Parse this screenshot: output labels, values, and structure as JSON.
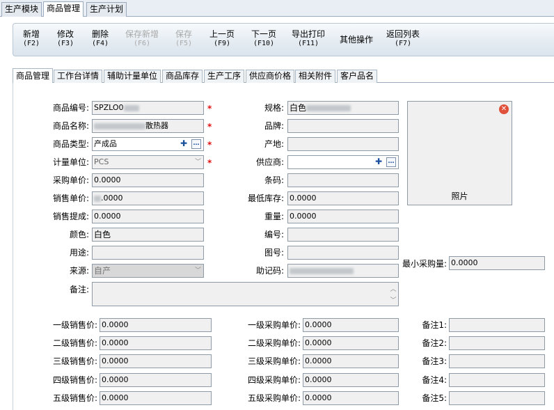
{
  "module_tabs": [
    "生产模块",
    "商品管理",
    "生产计划"
  ],
  "toolbar": {
    "new": {
      "label": "新增",
      "key": "(F2)"
    },
    "edit": {
      "label": "修改",
      "key": "(F3)"
    },
    "delete": {
      "label": "删除",
      "key": "(F4)"
    },
    "save_new": {
      "label": "保存新增",
      "key": "(F6)"
    },
    "save": {
      "label": "保存",
      "key": "(F5)"
    },
    "prev": {
      "label": "上一页",
      "key": "(F9)"
    },
    "next": {
      "label": "下一页",
      "key": "(F10)"
    },
    "export_print": {
      "label": "导出打印",
      "key": "(F11)"
    },
    "other": {
      "label": "其他操作"
    },
    "back": {
      "label": "返回列表",
      "key": "(F7)"
    }
  },
  "sub_tabs": [
    "商品管理",
    "工作台详情",
    "辅助计量单位",
    "商品库存",
    "生产工序",
    "供应商价格",
    "相关附件",
    "客户品名"
  ],
  "form": {
    "code": {
      "label": "商品编号:",
      "value": "SPZLO0"
    },
    "name": {
      "label": "商品名称:",
      "value": "散热器"
    },
    "type": {
      "label": "商品类型:",
      "value": "产成品"
    },
    "unit": {
      "label": "计量单位:",
      "value": "PCS"
    },
    "purchase_price": {
      "label": "采购单价:",
      "value": "0.0000"
    },
    "sale_price": {
      "label": "销售单价:",
      "value": ".0000"
    },
    "commission": {
      "label": "销售提成:",
      "value": "0.0000"
    },
    "color": {
      "label": "颜色:",
      "value": "白色"
    },
    "usage": {
      "label": "用途:",
      "value": ""
    },
    "source": {
      "label": "来源:",
      "value": "自产"
    },
    "remark": {
      "label": "备注:",
      "value": ""
    },
    "spec": {
      "label": "规格:",
      "value": "白色"
    },
    "brand": {
      "label": "品牌:",
      "value": ""
    },
    "origin": {
      "label": "产地:",
      "value": ""
    },
    "supplier": {
      "label": "供应商:",
      "value": ""
    },
    "barcode": {
      "label": "条码:",
      "value": ""
    },
    "min_stock": {
      "label": "最低库存:",
      "value": "0.0000"
    },
    "weight": {
      "label": "重量:",
      "value": "0.0000"
    },
    "number": {
      "label": "编号:",
      "value": ""
    },
    "drawing_no": {
      "label": "图号:",
      "value": ""
    },
    "mnemonic": {
      "label": "助记码:",
      "value": ""
    },
    "min_purchase": {
      "label": "最小采购量:",
      "value": "0.0000"
    },
    "photo_label": "照片",
    "sale_levels": [
      {
        "label": "一级销售价:",
        "value": "0.0000"
      },
      {
        "label": "二级销售价:",
        "value": "0.0000"
      },
      {
        "label": "三级销售价:",
        "value": "0.0000"
      },
      {
        "label": "四级销售价:",
        "value": "0.0000"
      },
      {
        "label": "五级销售价:",
        "value": "0.0000"
      }
    ],
    "purchase_levels": [
      {
        "label": "一级采购单价:",
        "value": "0.0000"
      },
      {
        "label": "二级采购单价:",
        "value": "0.0000"
      },
      {
        "label": "三级采购单价:",
        "value": "0.0000"
      },
      {
        "label": "四级采购单价:",
        "value": "0.0000"
      },
      {
        "label": "五级采购单价:",
        "value": "0.0000"
      }
    ],
    "remarks": [
      {
        "label": "备注1:",
        "value": ""
      },
      {
        "label": "备注2:",
        "value": ""
      },
      {
        "label": "备注3:",
        "value": ""
      },
      {
        "label": "备注4:",
        "value": ""
      },
      {
        "label": "备注5:",
        "value": ""
      }
    ]
  }
}
